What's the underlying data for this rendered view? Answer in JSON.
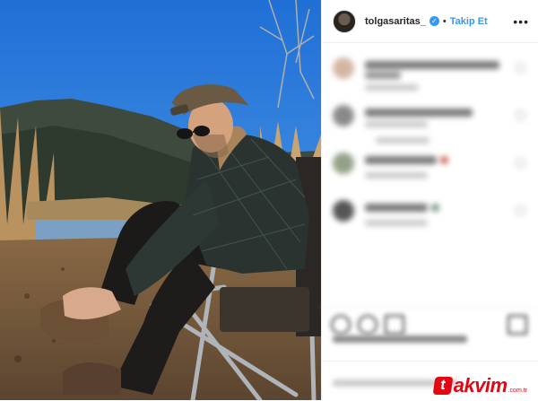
{
  "post": {
    "username": "tolgasaritas_",
    "verified": true,
    "separator": "•",
    "follow_label": "Takip Et",
    "more_icon": "more-options-icon",
    "photo_description_icon": "post-photo"
  },
  "watermark": {
    "mark": "t",
    "text": "akvim",
    "suffix": ".com.tr"
  },
  "colors": {
    "follow": "#3897f0",
    "watermark": "#e30613"
  }
}
